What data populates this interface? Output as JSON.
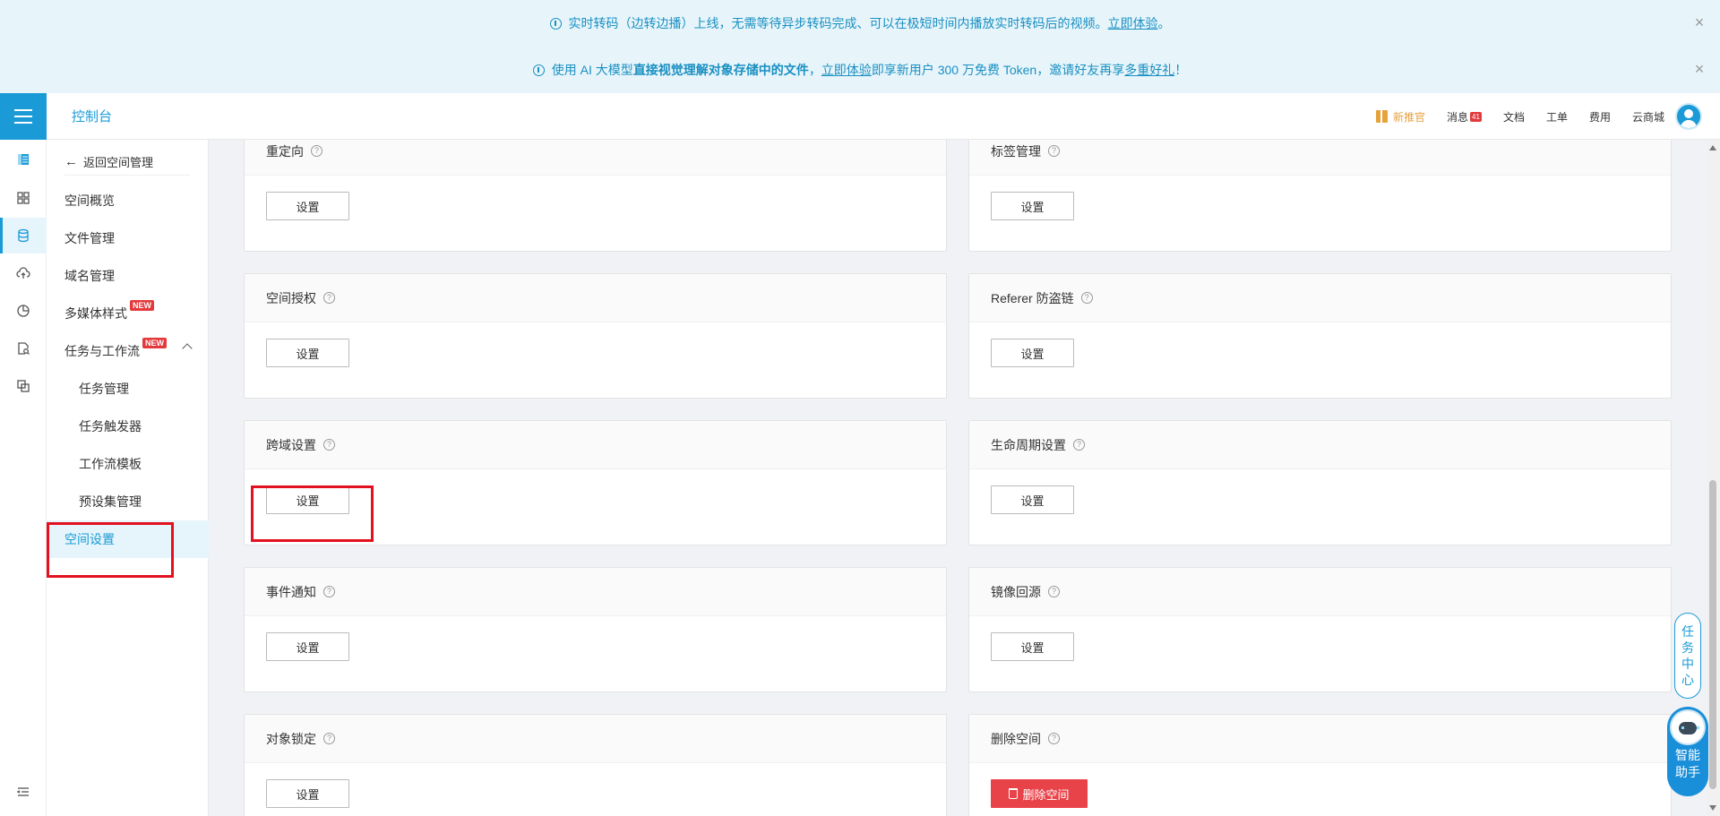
{
  "banners": [
    {
      "pre": "实时转码（边转边播）上线，无需等待异步转码完成、可以在极短时间内播放实时转码后的视频。",
      "link": "立即体验",
      "post": "。"
    },
    {
      "pre": "使用 AI 大模型",
      "bold": "直接视觉理解对象存储中的文件",
      "mid": "，",
      "link": "立即体验",
      "mid2": "即享新用户 300 万免费 Token，邀请好友再享",
      "link2": "多重好礼",
      "post": "！"
    }
  ],
  "header": {
    "title": "控制台",
    "links": {
      "promo": "新推官",
      "messages": "消息",
      "message_count": "41",
      "docs": "文档",
      "tickets": "工单",
      "billing": "费用",
      "store": "云商城"
    }
  },
  "sidebar": {
    "back": "返回空间管理",
    "items": {
      "overview": "空间概览",
      "files": "文件管理",
      "domains": "域名管理",
      "media": "多媒体样式",
      "workflow": "任务与工作流",
      "task_mgmt": "任务管理",
      "triggers": "任务触发器",
      "templates": "工作流模板",
      "presets": "预设集管理",
      "settings": "空间设置"
    },
    "new_tag": "NEW"
  },
  "cards": {
    "redirect": "重定向",
    "tags": "标签管理",
    "auth": "空间授权",
    "referer": "Referer 防盗链",
    "cors": "跨域设置",
    "lifecycle": "生命周期设置",
    "events": "事件通知",
    "mirror": "镜像回源",
    "lock": "对象锁定",
    "delete": "删除空间"
  },
  "buttons": {
    "set": "设置",
    "delete": "删除空间"
  },
  "floating": {
    "task_center": [
      "任",
      "务",
      "中",
      "心"
    ],
    "assistant": [
      "智能",
      "助手"
    ]
  },
  "colors": {
    "accent": "#1a9bd7",
    "danger": "#e9434a",
    "highlight": "#e3101f"
  }
}
